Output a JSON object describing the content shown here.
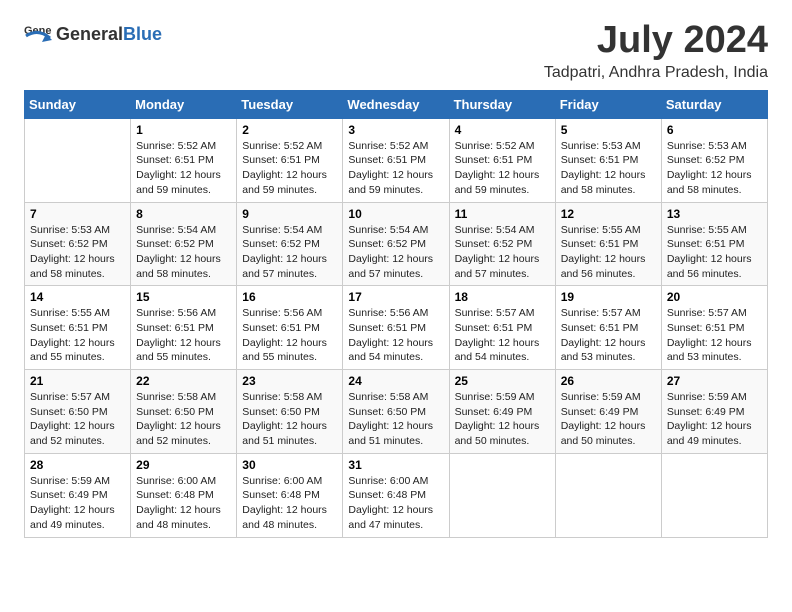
{
  "header": {
    "logo_general": "General",
    "logo_blue": "Blue",
    "title": "July 2024",
    "subtitle": "Tadpatri, Andhra Pradesh, India"
  },
  "weekdays": [
    "Sunday",
    "Monday",
    "Tuesday",
    "Wednesday",
    "Thursday",
    "Friday",
    "Saturday"
  ],
  "weeks": [
    [
      {
        "day": "",
        "info": ""
      },
      {
        "day": "1",
        "info": "Sunrise: 5:52 AM\nSunset: 6:51 PM\nDaylight: 12 hours\nand 59 minutes."
      },
      {
        "day": "2",
        "info": "Sunrise: 5:52 AM\nSunset: 6:51 PM\nDaylight: 12 hours\nand 59 minutes."
      },
      {
        "day": "3",
        "info": "Sunrise: 5:52 AM\nSunset: 6:51 PM\nDaylight: 12 hours\nand 59 minutes."
      },
      {
        "day": "4",
        "info": "Sunrise: 5:52 AM\nSunset: 6:51 PM\nDaylight: 12 hours\nand 59 minutes."
      },
      {
        "day": "5",
        "info": "Sunrise: 5:53 AM\nSunset: 6:51 PM\nDaylight: 12 hours\nand 58 minutes."
      },
      {
        "day": "6",
        "info": "Sunrise: 5:53 AM\nSunset: 6:52 PM\nDaylight: 12 hours\nand 58 minutes."
      }
    ],
    [
      {
        "day": "7",
        "info": "Sunrise: 5:53 AM\nSunset: 6:52 PM\nDaylight: 12 hours\nand 58 minutes."
      },
      {
        "day": "8",
        "info": "Sunrise: 5:54 AM\nSunset: 6:52 PM\nDaylight: 12 hours\nand 58 minutes."
      },
      {
        "day": "9",
        "info": "Sunrise: 5:54 AM\nSunset: 6:52 PM\nDaylight: 12 hours\nand 57 minutes."
      },
      {
        "day": "10",
        "info": "Sunrise: 5:54 AM\nSunset: 6:52 PM\nDaylight: 12 hours\nand 57 minutes."
      },
      {
        "day": "11",
        "info": "Sunrise: 5:54 AM\nSunset: 6:52 PM\nDaylight: 12 hours\nand 57 minutes."
      },
      {
        "day": "12",
        "info": "Sunrise: 5:55 AM\nSunset: 6:51 PM\nDaylight: 12 hours\nand 56 minutes."
      },
      {
        "day": "13",
        "info": "Sunrise: 5:55 AM\nSunset: 6:51 PM\nDaylight: 12 hours\nand 56 minutes."
      }
    ],
    [
      {
        "day": "14",
        "info": "Sunrise: 5:55 AM\nSunset: 6:51 PM\nDaylight: 12 hours\nand 55 minutes."
      },
      {
        "day": "15",
        "info": "Sunrise: 5:56 AM\nSunset: 6:51 PM\nDaylight: 12 hours\nand 55 minutes."
      },
      {
        "day": "16",
        "info": "Sunrise: 5:56 AM\nSunset: 6:51 PM\nDaylight: 12 hours\nand 55 minutes."
      },
      {
        "day": "17",
        "info": "Sunrise: 5:56 AM\nSunset: 6:51 PM\nDaylight: 12 hours\nand 54 minutes."
      },
      {
        "day": "18",
        "info": "Sunrise: 5:57 AM\nSunset: 6:51 PM\nDaylight: 12 hours\nand 54 minutes."
      },
      {
        "day": "19",
        "info": "Sunrise: 5:57 AM\nSunset: 6:51 PM\nDaylight: 12 hours\nand 53 minutes."
      },
      {
        "day": "20",
        "info": "Sunrise: 5:57 AM\nSunset: 6:51 PM\nDaylight: 12 hours\nand 53 minutes."
      }
    ],
    [
      {
        "day": "21",
        "info": "Sunrise: 5:57 AM\nSunset: 6:50 PM\nDaylight: 12 hours\nand 52 minutes."
      },
      {
        "day": "22",
        "info": "Sunrise: 5:58 AM\nSunset: 6:50 PM\nDaylight: 12 hours\nand 52 minutes."
      },
      {
        "day": "23",
        "info": "Sunrise: 5:58 AM\nSunset: 6:50 PM\nDaylight: 12 hours\nand 51 minutes."
      },
      {
        "day": "24",
        "info": "Sunrise: 5:58 AM\nSunset: 6:50 PM\nDaylight: 12 hours\nand 51 minutes."
      },
      {
        "day": "25",
        "info": "Sunrise: 5:59 AM\nSunset: 6:49 PM\nDaylight: 12 hours\nand 50 minutes."
      },
      {
        "day": "26",
        "info": "Sunrise: 5:59 AM\nSunset: 6:49 PM\nDaylight: 12 hours\nand 50 minutes."
      },
      {
        "day": "27",
        "info": "Sunrise: 5:59 AM\nSunset: 6:49 PM\nDaylight: 12 hours\nand 49 minutes."
      }
    ],
    [
      {
        "day": "28",
        "info": "Sunrise: 5:59 AM\nSunset: 6:49 PM\nDaylight: 12 hours\nand 49 minutes."
      },
      {
        "day": "29",
        "info": "Sunrise: 6:00 AM\nSunset: 6:48 PM\nDaylight: 12 hours\nand 48 minutes."
      },
      {
        "day": "30",
        "info": "Sunrise: 6:00 AM\nSunset: 6:48 PM\nDaylight: 12 hours\nand 48 minutes."
      },
      {
        "day": "31",
        "info": "Sunrise: 6:00 AM\nSunset: 6:48 PM\nDaylight: 12 hours\nand 47 minutes."
      },
      {
        "day": "",
        "info": ""
      },
      {
        "day": "",
        "info": ""
      },
      {
        "day": "",
        "info": ""
      }
    ]
  ]
}
